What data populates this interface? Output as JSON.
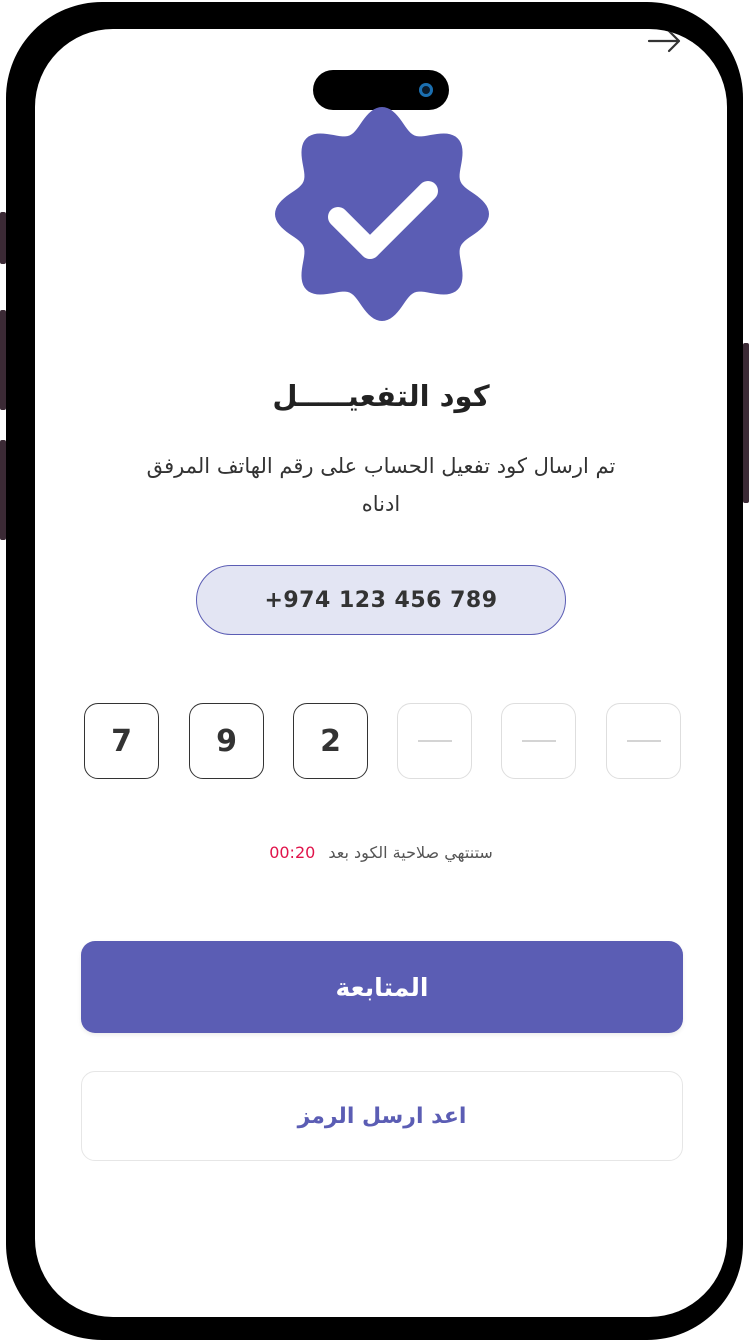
{
  "header": {
    "back_icon": "arrow-right-icon"
  },
  "badge": {
    "icon": "verified-badge-icon",
    "color": "#5b5db4"
  },
  "title": "كود التفعيـــــل",
  "subtitle": "تم ارسال كود تفعيل الحساب على رقم الهاتف المرفق ادناه",
  "phone_number": "+974 123 456 789",
  "otp": {
    "digits": [
      "7",
      "9",
      "2",
      "",
      "",
      ""
    ]
  },
  "timer": {
    "label": "ستنتهي صلاحية الكود بعد",
    "time": "00:20",
    "time_color": "#e0134a"
  },
  "buttons": {
    "continue_label": "المتابعة",
    "resend_label": "اعد ارسل الرمز"
  },
  "colors": {
    "accent": "#5b5db4",
    "pill_bg": "#e3e5f3"
  }
}
